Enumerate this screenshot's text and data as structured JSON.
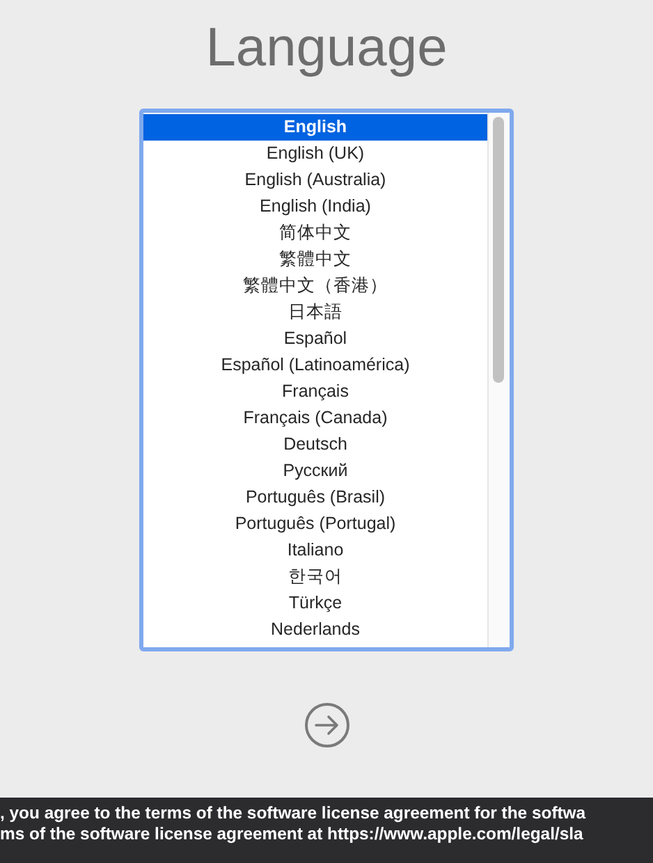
{
  "title": "Language",
  "languages": [
    {
      "label": "English",
      "selected": true
    },
    {
      "label": "English (UK)",
      "selected": false
    },
    {
      "label": "English (Australia)",
      "selected": false
    },
    {
      "label": "English (India)",
      "selected": false
    },
    {
      "label": "简体中文",
      "selected": false
    },
    {
      "label": "繁體中文",
      "selected": false
    },
    {
      "label": "繁體中文（香港）",
      "selected": false
    },
    {
      "label": "日本語",
      "selected": false
    },
    {
      "label": "Español",
      "selected": false
    },
    {
      "label": "Español (Latinoamérica)",
      "selected": false
    },
    {
      "label": "Français",
      "selected": false
    },
    {
      "label": "Français (Canada)",
      "selected": false
    },
    {
      "label": "Deutsch",
      "selected": false
    },
    {
      "label": "Русский",
      "selected": false
    },
    {
      "label": "Português (Brasil)",
      "selected": false
    },
    {
      "label": "Português (Portugal)",
      "selected": false
    },
    {
      "label": "Italiano",
      "selected": false
    },
    {
      "label": "한국어",
      "selected": false
    },
    {
      "label": "Türkçe",
      "selected": false
    },
    {
      "label": "Nederlands",
      "selected": false
    }
  ],
  "license_banner": [
    ", you agree to the terms of the software license agreement for the softwa",
    "ms of the software license agreement at https://www.apple.com/legal/sla"
  ]
}
